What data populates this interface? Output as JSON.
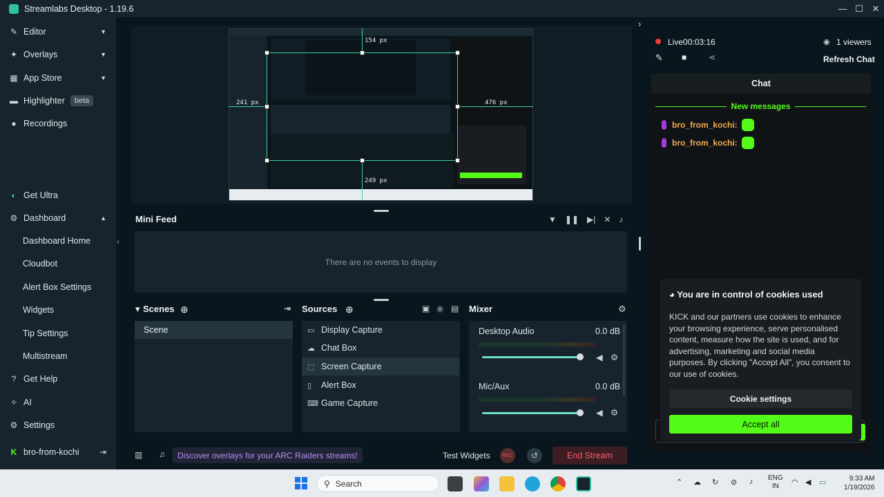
{
  "window": {
    "title": "Streamlabs Desktop - 1.19.6",
    "minimize": "—",
    "maximize": "☐",
    "close": "✕"
  },
  "sidebar": {
    "items": [
      {
        "label": "Editor"
      },
      {
        "label": "Overlays"
      },
      {
        "label": "App Store"
      },
      {
        "label": "Highlighter",
        "badge": "beta"
      },
      {
        "label": "Recordings"
      },
      {
        "label": "Get Ultra"
      },
      {
        "label": "Dashboard"
      },
      {
        "label": "Dashboard Home"
      },
      {
        "label": "Cloudbot"
      },
      {
        "label": "Alert Box Settings"
      },
      {
        "label": "Widgets"
      },
      {
        "label": "Tip Settings"
      },
      {
        "label": "Multistream"
      },
      {
        "label": "Get Help"
      },
      {
        "label": "AI"
      },
      {
        "label": "Settings"
      },
      {
        "label": "bro-from-kochi"
      }
    ]
  },
  "preview": {
    "labels": {
      "top": "154 px",
      "left": "241 px",
      "right": "476 px",
      "bottom": "249 px"
    }
  },
  "minifeed": {
    "title": "Mini Feed",
    "empty": "There are no events to display"
  },
  "scenes": {
    "title": "Scenes",
    "items": [
      "Scene"
    ]
  },
  "sources": {
    "title": "Sources",
    "items": [
      "Display Capture",
      "Chat Box",
      "Screen Capture",
      "Alert Box",
      "Game Capture"
    ]
  },
  "mixer": {
    "title": "Mixer",
    "channels": [
      {
        "name": "Desktop Audio",
        "level": "0.0 dB"
      },
      {
        "name": "Mic/Aux",
        "level": "0.0 dB"
      }
    ]
  },
  "bottom": {
    "discover": "Discover overlays for your ARC Raiders streams!",
    "test_widgets": "Test Widgets",
    "rec": "REC",
    "end_stream": "End Stream"
  },
  "chat": {
    "live": "Live",
    "timer": "00:03:16",
    "viewers": "1 viewers",
    "refresh": "Refresh Chat",
    "title": "Chat",
    "new_messages": "New messages",
    "messages": [
      {
        "user": "bro_from_kochi:"
      },
      {
        "user": "bro_from_kochi:"
      }
    ]
  },
  "cookie": {
    "title": "You are in control of cookies used",
    "text": "KICK and our partners use cookies to enhance your browsing experience, serve personalised content, measure how the site is used, and for advertising, marketing and social media purposes. By clicking \"Accept All\", you consent to our use of cookies.",
    "settings": "Cookie settings",
    "accept": "Accept all"
  },
  "taskbar": {
    "search": "Search",
    "lang1": "ENG",
    "lang2": "IN",
    "time": "9:33 AM",
    "date": "1/19/2026"
  },
  "colors": {
    "accent": "#31c3a2",
    "kick_green": "#53fc18",
    "end_stream": "#ff5d66"
  }
}
